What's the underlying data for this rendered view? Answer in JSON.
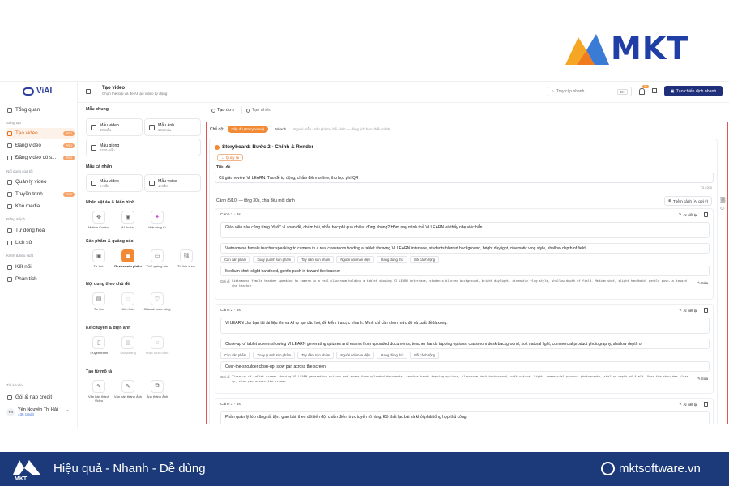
{
  "brand": {
    "name": "MKT"
  },
  "sidebar": {
    "logo": "ViAI",
    "items": [
      {
        "label": "Tổng quan",
        "badge": ""
      },
      {
        "label": "Tạo video",
        "badge": "PRO"
      },
      {
        "label": "Đăng video",
        "badge": "PRO"
      },
      {
        "label": "Đăng video có s...",
        "badge": "PRO"
      },
      {
        "label": "Quản lý video",
        "badge": ""
      },
      {
        "label": "Truyền trình",
        "badge": "PRO"
      },
      {
        "label": "Kho media",
        "badge": ""
      },
      {
        "label": "Tự động hoá",
        "badge": ""
      },
      {
        "label": "Lịch sử",
        "badge": ""
      },
      {
        "label": "Kết nối",
        "badge": ""
      },
      {
        "label": "Phân tích",
        "badge": ""
      },
      {
        "label": "Gói & nạp credit",
        "badge": ""
      }
    ],
    "sections": [
      "Sáng tạo",
      "Nội dung của tôi",
      "Đăng & lịch",
      "Kênh & tiêu suất",
      "Tài khoản"
    ],
    "user": {
      "initials": "YN",
      "name": "Yến Nguyễn Thị Hải",
      "credit": "436 credit"
    }
  },
  "topbar": {
    "title": "Tạo video",
    "subtitle": "Chọn thể loại và để AI tạo video tự động",
    "search_placeholder": "Truy cập nhanh...",
    "search_key": "⌘K",
    "notif_count": "9+",
    "cta": "Tạo chiến dịch nhanh"
  },
  "left_panel": {
    "templates_title": "Mẫu chung",
    "templates": [
      {
        "label": "Mẫu video",
        "count": "98 mẫu"
      },
      {
        "label": "Mẫu ảnh",
        "count": "104 mẫu"
      },
      {
        "label": "Mẫu giọng",
        "count": "6220 mẫu"
      }
    ],
    "personal_title": "Mẫu cá nhân",
    "personal": [
      {
        "label": "Mẫu video",
        "count": "0 mẫu"
      },
      {
        "label": "Mẫu voice",
        "count": "1 mẫu"
      }
    ],
    "groups": [
      {
        "title": "Nhân vật ảo & biển hình",
        "tools": [
          "Motion Control",
          "AI Avatar",
          "Hiệu ứng AI"
        ]
      },
      {
        "title": "Sản phẩm & quảng cáo",
        "tools": [
          "Từ ảnh",
          "Review sản phẩm",
          "TVC quảng cáo",
          "Từ link shop"
        ]
      },
      {
        "title": "Nội dung theo chủ đề",
        "tools": [
          "Tin tức",
          "Kiến thức",
          "Chia sẻ cuộc sống"
        ]
      },
      {
        "title": "Kể chuyện & điện ảnh",
        "tools": [
          "Truyện tranh",
          "Storytelling",
          "Nhạc kịch Video"
        ]
      },
      {
        "title": "Tạo từ mô tả",
        "tools": [
          "Văn bản thành Video",
          "Văn bản thành Ảnh",
          "Ảnh thành Ảnh"
        ]
      }
    ]
  },
  "main": {
    "tabs": [
      "Tạo đơn",
      "Tạo nhiều"
    ],
    "mode_label": "Chế độ:",
    "mode_on": "Đầy đủ (Storyboard)",
    "mode_off": "Nhanh",
    "mode_hint": "Người mẫu › sản phẩm › bối cảnh — dùng lịch bản nhiều cảnh",
    "step_title": "Storyboard: Bước 2 · Chỉnh & Render",
    "back": "← Quay lại",
    "title_label": "Tiêu đề",
    "title_value": "Cô giáo review VI LEARN: Tạo đề tự động, chấm điểm online, thu học phí QR",
    "title_counter": "73 / 200",
    "scenes_label": "Cảnh (5/10) — tổng 30s, chia đều mỗi cảnh",
    "add_scene": "Thêm cảnh (AI gợi ý)",
    "ai_rewrite": "AI viết lại",
    "style_tag": "Gửi đi",
    "edit": "Sửa",
    "chips": [
      "Cận sản phẩm",
      "Xoay quanh sản phẩm",
      "Tay cầm sản phẩm",
      "Người nói man điện",
      "Đang dùng thử",
      "Bối cảnh rộng"
    ],
    "scenes": [
      {
        "header": "Cảnh 1 · 6s",
        "script": "Giáo viên nào cũng từng \"đuối\" vì soạn đề, chấm bài, nhắc học phí quá nhiều, đúng không? Hôm nay mình thử VI LEARN và thấy nhẹ việc hẳn.",
        "prompt": "Vietnamese female teacher speaking to camera in a real classroom holding a tablet showing VI LEARN interface, students blurred background, bright daylight, cinematic vlog style, shallow depth of field",
        "camera": "Medium shot, slight handheld, gentle push-in toward the teacher",
        "final": "Vietnamese female teacher speaking to camera in a real classroom holding a tablet showing VI LEARN interface, students blurred background, bright daylight, cinematic vlog style, shallow depth of field. Medium shot, slight handheld, gentle push-in toward the teacher"
      },
      {
        "header": "Cảnh 2 · 6s",
        "script": "VI LEARN cho bạn tải tài liệu lên và AI tự tạo câu hỏi, đề kiểm tra cực nhanh. Mình chỉ cần chọn mức độ và xuất đề là xong.",
        "prompt": "Close-up of tablet screen showing VI LEARN generating quizzes and exams from uploaded documents, teacher hands tapping options, classroom desk background, soft natural light, commercial product photography, shallow depth of",
        "camera": "Over-the-shoulder close-up, slow pan across the screen",
        "final": "Close-up of tablet screen showing VI LEARN generating quizzes and exams from uploaded documents, teacher hands tapping options, classroom desk background, soft natural light, commercial product photography, shallow depth of field. Over-the-shoulder close-up, slow pan across the screen"
      },
      {
        "header": "Cảnh 3 · 6s",
        "script": "Phần quản lý lớp cũng rất tiện: giao bài, theo dõi tiến độ, chấm điểm trực tuyến rõ ràng. Đỡ thất lạc bài và khỏi phải tổng hợp thủ công."
      }
    ]
  },
  "footer": {
    "slogan": "Hiệu quả - Nhanh - Dễ dùng",
    "site": "mktsoftware.vn"
  }
}
